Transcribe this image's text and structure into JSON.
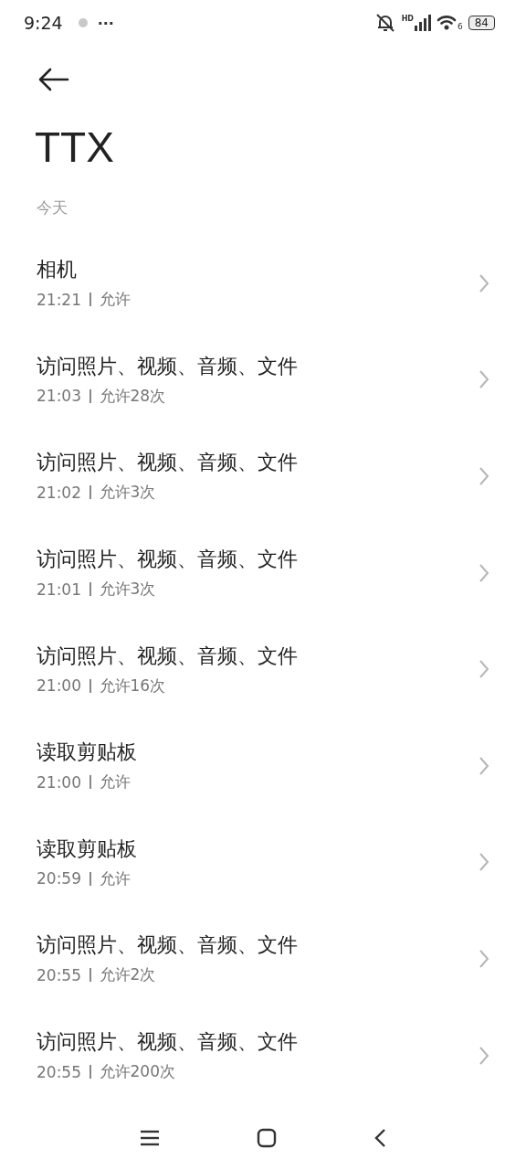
{
  "status_bar": {
    "time": "9:24",
    "more": "···",
    "network_label": "HD",
    "wifi_label": "6",
    "battery": "84"
  },
  "title": "TTX",
  "section": "今天",
  "records": [
    {
      "name": "相机",
      "time": "21:21",
      "result": "允许"
    },
    {
      "name": "访问照片、视频、音频、文件",
      "time": "21:03",
      "result": "允许28次"
    },
    {
      "name": "访问照片、视频、音频、文件",
      "time": "21:02",
      "result": "允许3次"
    },
    {
      "name": "访问照片、视频、音频、文件",
      "time": "21:01",
      "result": "允许3次"
    },
    {
      "name": "访问照片、视频、音频、文件",
      "time": "21:00",
      "result": "允许16次"
    },
    {
      "name": "读取剪贴板",
      "time": "21:00",
      "result": "允许"
    },
    {
      "name": "读取剪贴板",
      "time": "20:59",
      "result": "允许"
    },
    {
      "name": "访问照片、视频、音频、文件",
      "time": "20:55",
      "result": "允许2次"
    },
    {
      "name": "访问照片、视频、音频、文件",
      "time": "20:55",
      "result": "允许200次"
    }
  ]
}
